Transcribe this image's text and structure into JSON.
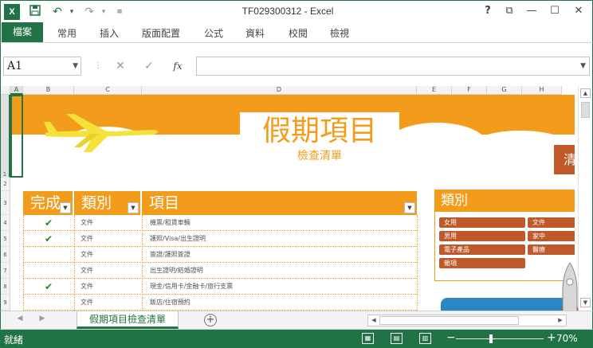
{
  "window": {
    "title": "TF029300312 - Excel",
    "logo": "X",
    "help": "?",
    "controls": {
      "restore": "⧉",
      "minimize": "—",
      "maximize": "☐",
      "close": "✕"
    }
  },
  "qat": {
    "save_icon": "save-icon",
    "undo_icon": "undo-icon",
    "redo_icon": "redo-icon"
  },
  "ribbon": {
    "file_tab": "檔案",
    "tabs": [
      "常用",
      "插入",
      "版面配置",
      "公式",
      "資料",
      "校閱",
      "檢視"
    ]
  },
  "formula_bar": {
    "name_box": "A1",
    "cancel": "✕",
    "enter": "✓",
    "fx": "fx",
    "value": ""
  },
  "grid": {
    "columns": [
      "A",
      "B",
      "C",
      "D",
      "E",
      "F",
      "G",
      "H"
    ],
    "selected_column": "A",
    "rows": [
      "1",
      "2",
      "3",
      "4",
      "5",
      "6",
      "7",
      "8",
      "9"
    ]
  },
  "banner": {
    "title": "假期項目",
    "subtitle": "檢查清單",
    "side_tab": "清"
  },
  "table": {
    "headers": [
      "完成",
      "類別",
      "項目"
    ],
    "rows": [
      {
        "done": "✔",
        "category": "文件",
        "item": "機票/租賃車輛"
      },
      {
        "done": "✔",
        "category": "文件",
        "item": "護照/Visa/出生證明"
      },
      {
        "done": "",
        "category": "文件",
        "item": "簽證/護照簽證"
      },
      {
        "done": "",
        "category": "文件",
        "item": "出生證明/結婚證明"
      },
      {
        "done": "✔",
        "category": "文件",
        "item": "現金/信用卡/金融卡/旅行支票"
      },
      {
        "done": "",
        "category": "文件",
        "item": "飯店/住宿預約"
      }
    ]
  },
  "category_panel": {
    "title": "類別",
    "items": [
      "女用",
      "文件",
      "男用",
      "家中",
      "電子產品",
      "醫療",
      "雜項"
    ]
  },
  "sheet_tabs": {
    "active": "假期項目檢查清單",
    "add": "+"
  },
  "status": {
    "ready": "就緒",
    "zoom_minus": "−",
    "zoom_plus": "+",
    "zoom": "70%",
    "zoom_fraction": 0.4
  },
  "colors": {
    "excel_green": "#217346",
    "orange": "#f39c1c",
    "rust": "#c0592a",
    "check_green": "#2e7d32",
    "blue": "#2b86c6"
  }
}
